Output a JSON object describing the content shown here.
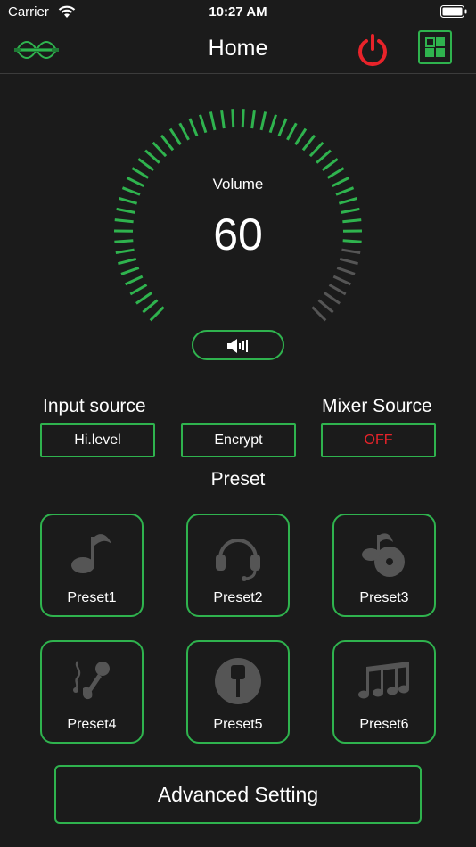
{
  "status_bar": {
    "carrier": "Carrier",
    "time": "10:27 AM"
  },
  "navbar": {
    "title": "Home",
    "logo_icon": "brand-logo-icon",
    "power_icon": "power-icon",
    "menu_icon": "grid-menu-icon"
  },
  "volume": {
    "label": "Volume",
    "value": "60",
    "level": 0.85,
    "mute_icon": "speaker-icon"
  },
  "input_source": {
    "label": "Input source",
    "value": "Hi.level"
  },
  "encrypt": {
    "value": "Encrypt"
  },
  "mixer_source": {
    "label": "Mixer Source",
    "value": "OFF"
  },
  "preset_title": "Preset",
  "presets": [
    {
      "label": "Preset1",
      "icon": "music-note-icon"
    },
    {
      "label": "Preset2",
      "icon": "headset-icon"
    },
    {
      "label": "Preset3",
      "icon": "music-disc-icon"
    },
    {
      "label": "Preset4",
      "icon": "singer-microphone-icon"
    },
    {
      "label": "Preset5",
      "icon": "microphone-icon"
    },
    {
      "label": "Preset6",
      "icon": "music-notes-icon"
    }
  ],
  "advanced": {
    "label": "Advanced Setting"
  },
  "colors": {
    "accent": "#2fb34e",
    "off": "#e8232a",
    "inactive": "#555555",
    "background": "#1b1b1b"
  }
}
